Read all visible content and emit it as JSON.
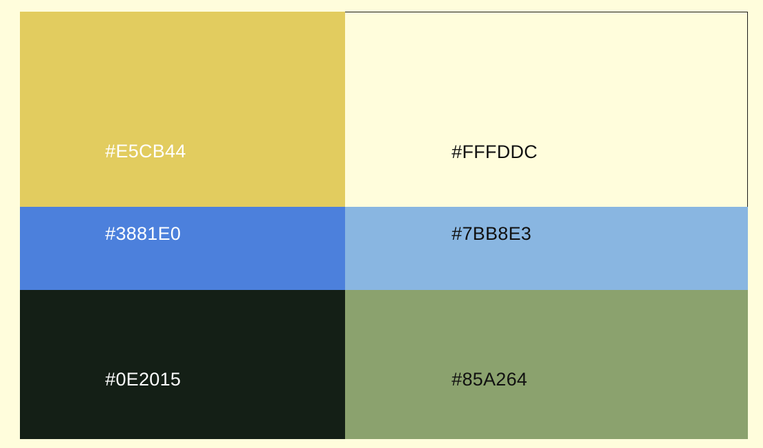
{
  "swatches": [
    {
      "hex": "#E5CB44",
      "color": "#E2CC5F",
      "text_color": "#FFFFFF"
    },
    {
      "hex": "#FFFDDC",
      "color": "#FFFDDC",
      "text_color": "#111111"
    },
    {
      "hex": "#3881E0",
      "color": "#4C80DC",
      "text_color": "#FFFFFF"
    },
    {
      "hex": "#7BB8E3",
      "color": "#89B6E1",
      "text_color": "#111111"
    },
    {
      "hex": "#0E2015",
      "color": "#141F16",
      "text_color": "#FFFFFF"
    },
    {
      "hex": "#85A264",
      "color": "#8BA26E",
      "text_color": "#111111"
    }
  ]
}
